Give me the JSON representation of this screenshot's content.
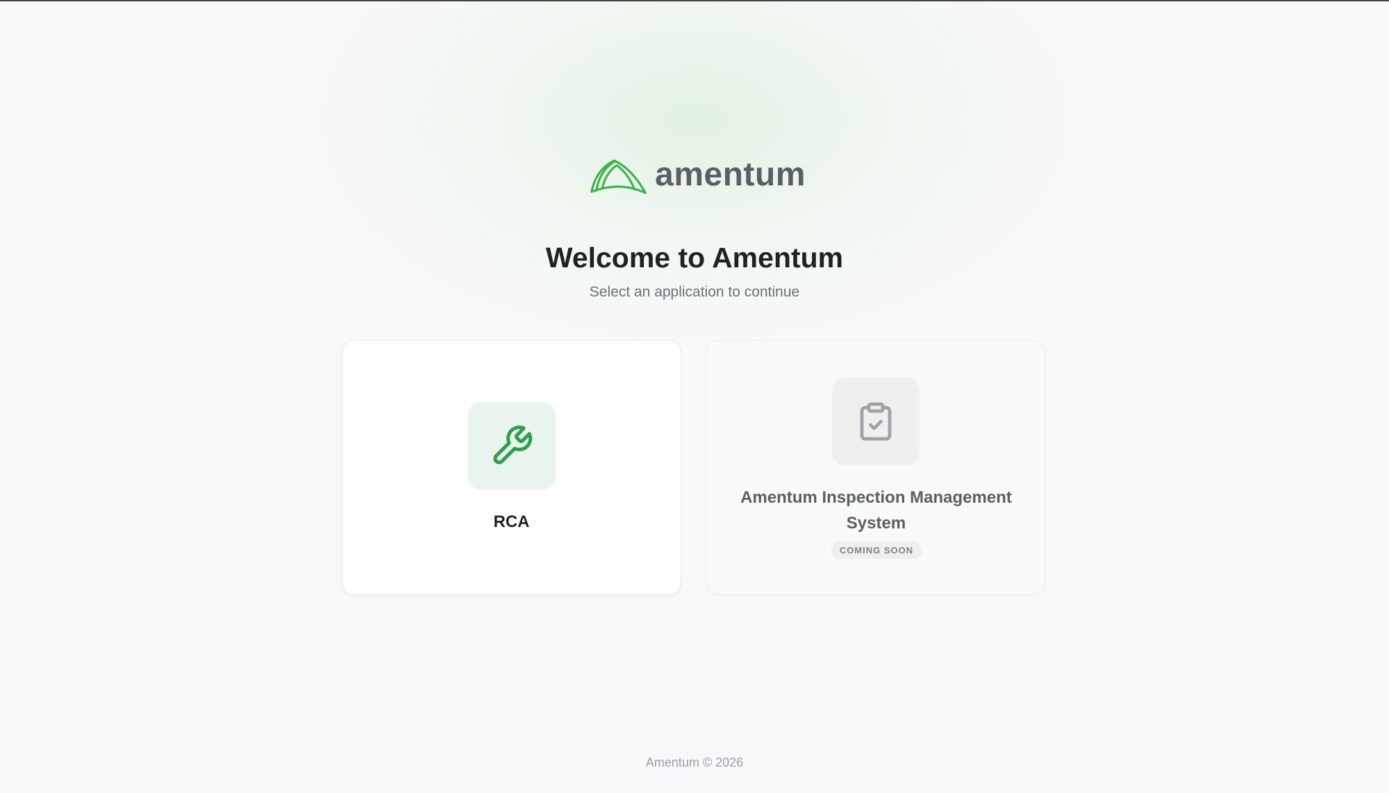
{
  "brand": {
    "name": "amentum",
    "icon": "amentum-logo-icon",
    "color": "#3ab54a"
  },
  "header": {
    "title": "Welcome to Amentum",
    "subtitle": "Select an application to continue"
  },
  "apps": [
    {
      "label": "RCA",
      "icon": "wrench-icon",
      "accent": "#2e9e4f",
      "status": "available"
    },
    {
      "label": "Amentum Inspection Management System",
      "icon": "clipboard-check-icon",
      "accent": "#9fa3a8",
      "status": "disabled",
      "badge": "COMING SOON"
    }
  ],
  "footer": {
    "text": "Amentum © 2026"
  }
}
